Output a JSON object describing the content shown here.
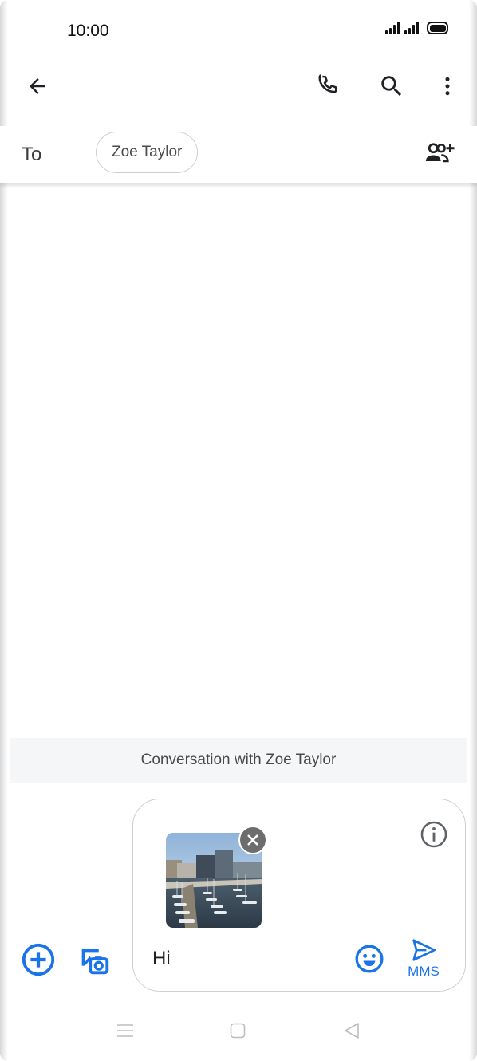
{
  "status_bar": {
    "time": "10:00"
  },
  "app_bar": {
    "back_icon": "arrow-left-icon",
    "call_icon": "phone-icon",
    "search_icon": "search-icon",
    "more_icon": "more-vert-icon"
  },
  "to_row": {
    "label": "To",
    "recipient": "Zoe Taylor",
    "add_icon": "person-add-icon"
  },
  "conversation": {
    "banner": "Conversation with Zoe Taylor"
  },
  "compose": {
    "attach_icon": "add-circle-icon",
    "gallery_icon": "gallery-camera-icon",
    "info_icon": "info-icon",
    "message_text": "Hi",
    "emoji_icon": "emoji-icon",
    "send_icon": "send-icon",
    "send_label": "MMS"
  },
  "colors": {
    "accent": "#1a73e8",
    "text": "#202124",
    "muted": "#4a4a4a"
  }
}
